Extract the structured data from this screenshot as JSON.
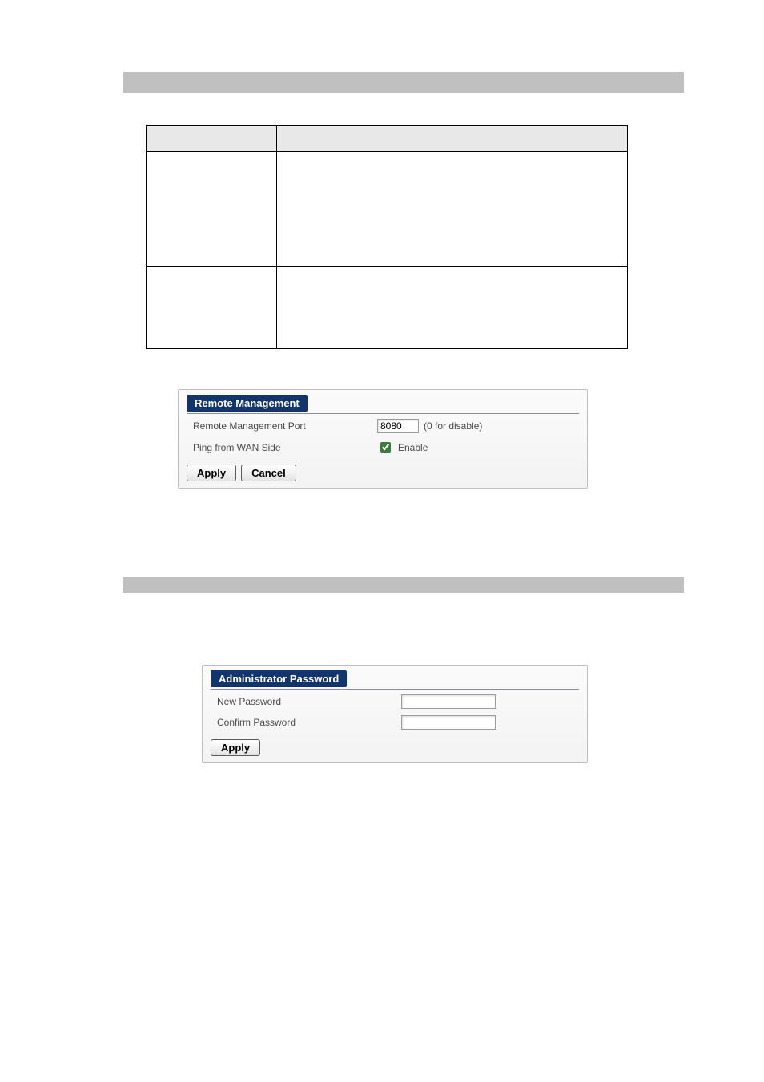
{
  "gray_bars": {
    "top": true,
    "mid": true
  },
  "spec_table": {
    "header": {
      "a": "",
      "b": ""
    },
    "rows": [
      {
        "a": "",
        "b": ""
      },
      {
        "a": "",
        "b": ""
      }
    ]
  },
  "remote_panel": {
    "title": "Remote Management",
    "port_label": "Remote Management Port",
    "port_value": "8080",
    "port_hint": "(0 for disable)",
    "ping_label": "Ping from WAN Side",
    "ping_checked": true,
    "ping_checkbox_label": "Enable",
    "apply_label": "Apply",
    "cancel_label": "Cancel"
  },
  "admin_panel": {
    "title": "Administrator Password",
    "new_pw_label": "New Password",
    "new_pw_value": "",
    "confirm_pw_label": "Confirm Password",
    "confirm_pw_value": "",
    "apply_label": "Apply"
  }
}
